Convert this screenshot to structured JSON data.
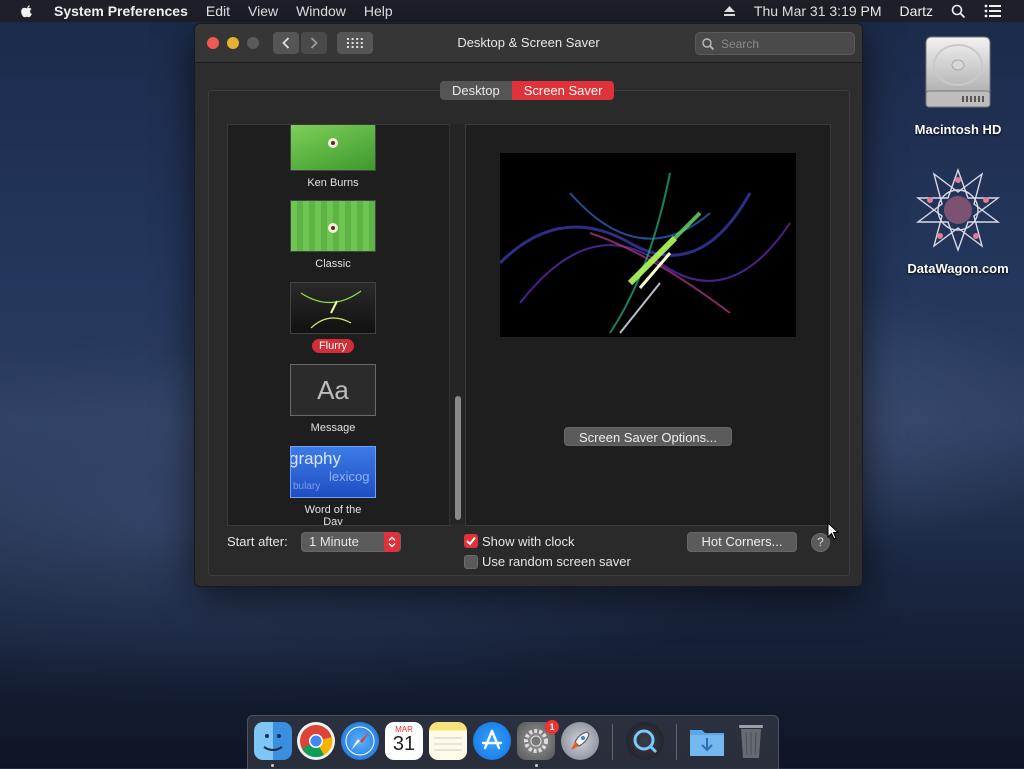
{
  "menubar": {
    "app_name": "System Preferences",
    "items": [
      "Edit",
      "View",
      "Window",
      "Help"
    ],
    "date_time": "Thu Mar 31  3:19 PM",
    "user": "Dartz"
  },
  "desktop": {
    "icons": [
      {
        "label": "Macintosh HD",
        "icon": "hard-drive-icon"
      },
      {
        "label": "DataWagon.com",
        "icon": "star-logo-icon"
      }
    ]
  },
  "window": {
    "title": "Desktop & Screen Saver",
    "search_placeholder": "Search",
    "tabs": [
      {
        "label": "Desktop",
        "selected": false
      },
      {
        "label": "Screen Saver",
        "selected": true
      }
    ]
  },
  "screensavers": {
    "items": [
      {
        "label": "Ken Burns",
        "selected": false
      },
      {
        "label": "Classic",
        "selected": false
      },
      {
        "label": "Flurry",
        "selected": true
      },
      {
        "label": "Message",
        "selected": false,
        "thumb_text": "Aa"
      },
      {
        "label": "Word of the Day",
        "selected": false,
        "thumb_text": "graphy",
        "thumb_text2": "lexicog",
        "thumb_text3": "bulary"
      }
    ]
  },
  "preview": {
    "options_button": "Screen Saver Options..."
  },
  "bottom": {
    "start_after_label": "Start after:",
    "start_after_value": "1 Minute",
    "show_with_clock_label": "Show with clock",
    "show_with_clock_checked": true,
    "random_label": "Use random screen saver",
    "random_checked": false,
    "hot_corners_button": "Hot Corners...",
    "help_symbol": "?"
  },
  "dock": {
    "items": [
      "Finder",
      "Google Chrome",
      "Safari",
      "Calendar",
      "Notes",
      "App Store",
      "System Preferences",
      "Launchpad",
      "QuickTime Player",
      "Downloads",
      "Trash"
    ],
    "calendar_month": "MAR",
    "calendar_day": "31",
    "system_prefs_badge": "1"
  },
  "colors": {
    "accent": "#e0323a",
    "window_bg": "#2d2d2d",
    "panel_bg": "#1e1e1e"
  }
}
